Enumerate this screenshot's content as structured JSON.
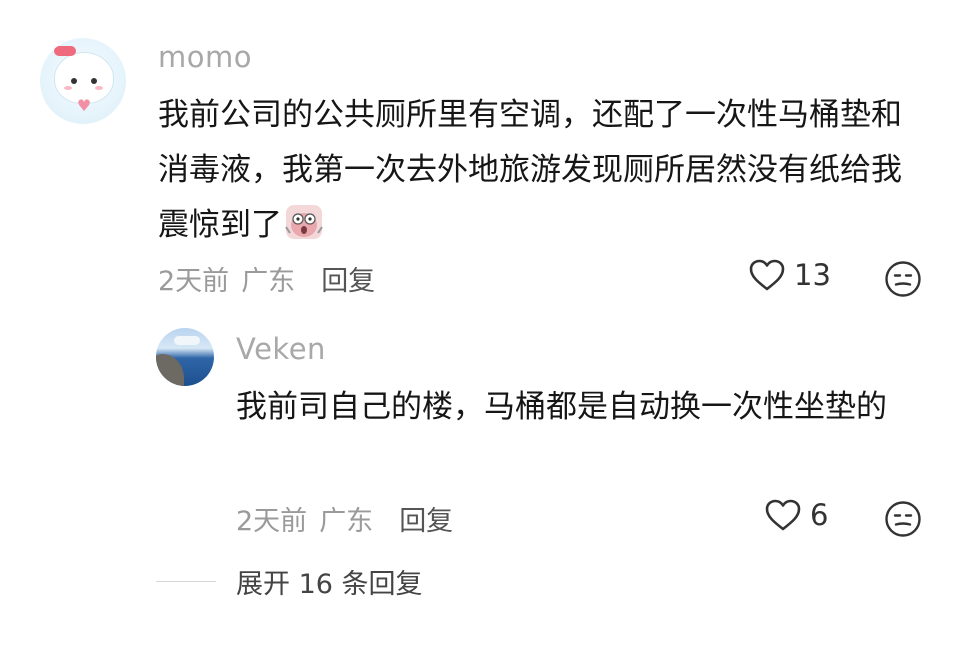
{
  "comment": {
    "username": "momo",
    "text": "我前公司的公共厕所里有空调，还配了一次性马桶垫和消毒液，我第一次去外地旅游发现厕所居然没有纸给我震惊到了",
    "sticker_icon": "shocked-sticker-icon",
    "time": "2天前",
    "location": "广东",
    "reply_label": "回复",
    "likes": "13",
    "like_icon": "heart-outline-icon",
    "dislike_icon": "meh-face-icon"
  },
  "reply": {
    "username": "Veken",
    "text": "我前司自己的楼，马桶都是自动换一次性坐垫的",
    "time": "2天前",
    "location": "广东",
    "reply_label": "回复",
    "likes": "6",
    "like_icon": "heart-outline-icon",
    "dislike_icon": "meh-face-icon"
  },
  "expand": {
    "label": "展开 16 条回复"
  }
}
